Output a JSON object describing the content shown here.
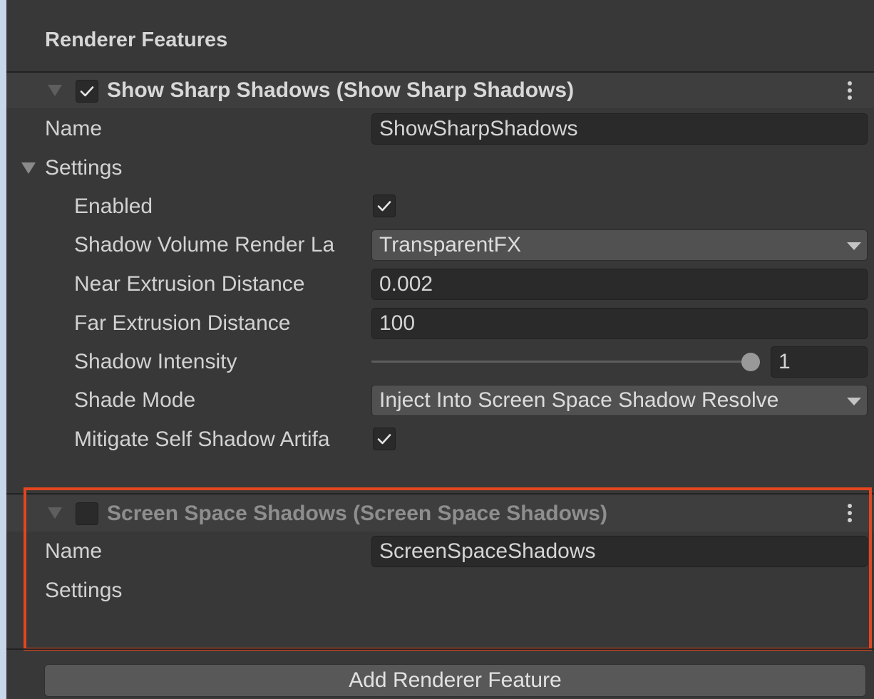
{
  "section_title": "Renderer Features",
  "features": [
    {
      "title": "Show Sharp Shadows (Show Sharp Shadows)",
      "enabled": true,
      "name_label": "Name",
      "name_value": "ShowSharpShadows",
      "settings_label": "Settings",
      "settings": {
        "enabled_label": "Enabled",
        "enabled_checked": true,
        "shadow_volume_label": "Shadow Volume Render La",
        "shadow_volume_value": "TransparentFX",
        "near_extrusion_label": "Near Extrusion Distance",
        "near_extrusion_value": "0.002",
        "far_extrusion_label": "Far Extrusion Distance",
        "far_extrusion_value": "100",
        "shadow_intensity_label": "Shadow Intensity",
        "shadow_intensity_value": "1",
        "shadow_intensity_fraction": 1.0,
        "shade_mode_label": "Shade Mode",
        "shade_mode_value": "Inject Into Screen Space Shadow Resolve",
        "mitigate_label": "Mitigate Self Shadow Artifa",
        "mitigate_checked": true
      }
    },
    {
      "title": "Screen Space Shadows (Screen Space Shadows)",
      "enabled": false,
      "name_label": "Name",
      "name_value": "ScreenSpaceShadows",
      "settings_label": "Settings"
    }
  ],
  "add_button_label": "Add Renderer Feature",
  "colors": {
    "background": "#383838",
    "highlight": "#e4461f",
    "disabled_text": "#8e8e8e"
  },
  "icons": [
    "foldout-triangle-icon",
    "checkmark-icon",
    "kebab-menu-icon",
    "dropdown-arrow-icon",
    "slider-handle"
  ]
}
